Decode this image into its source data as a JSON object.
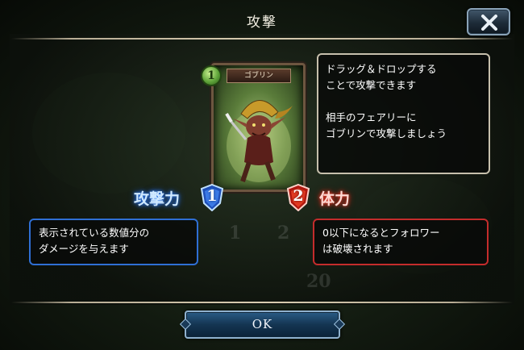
{
  "dialog": {
    "title": "攻撃",
    "ok_label": "OK"
  },
  "card": {
    "name": "ゴブリン",
    "cost": "1",
    "attack": "1",
    "defense": "2"
  },
  "tooltips": {
    "drag_line1": "ドラッグ＆ドロップする",
    "drag_line2": "ことで攻撃できます",
    "drag_line3": "相手のフェアリーに",
    "drag_line4": "ゴブリンで攻撃しましょう",
    "attack_line1": "表示されている数値分の",
    "attack_line2": "ダメージを与えます",
    "hp_line1": "0以下になるとフォロワー",
    "hp_line2": "は破壊されます"
  },
  "labels": {
    "attack": "攻撃力",
    "hp": "体力"
  },
  "background_numbers": [
    "1",
    "2",
    "20"
  ],
  "colors": {
    "attack_accent": "#2f6fd4",
    "hp_accent": "#c42c2c",
    "cost_gem": "#5fa43a"
  },
  "icons": {
    "close": "close-x-icon",
    "attack_badge": "attack-shield-icon",
    "hp_badge": "hp-shield-icon"
  }
}
